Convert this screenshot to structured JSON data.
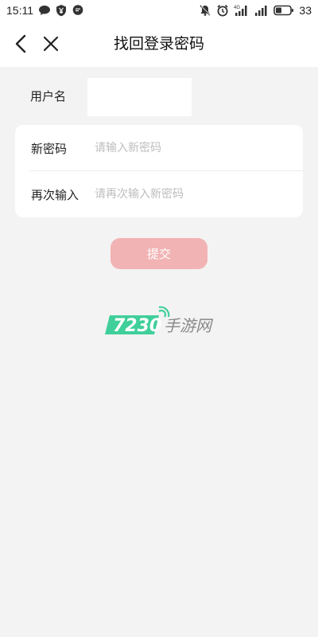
{
  "status_bar": {
    "time": "15:11",
    "battery_level": "33",
    "left_icons": [
      "chat-bubble-icon",
      "shield-yen-icon",
      "message-icon"
    ],
    "right_icons": [
      "mute-bell-icon",
      "alarm-icon",
      "4g-signal-icon",
      "signal-icon",
      "battery-icon"
    ],
    "network_label": "4G"
  },
  "nav": {
    "title": "找回登录密码",
    "back_icon": "chevron-left-icon",
    "close_icon": "close-icon"
  },
  "form": {
    "username_label": "用户名",
    "username_value": "",
    "new_password_label": "新密码",
    "new_password_placeholder": "请输入新密码",
    "confirm_password_label": "再次输入",
    "confirm_password_placeholder": "请再次输入新密码",
    "submit_label": "提交"
  },
  "watermark": {
    "number": "7230",
    "brand_text": "手游网"
  },
  "colors": {
    "background": "#f3f3f3",
    "submit_button": "#f2b3b4",
    "watermark_green": "#3fcf9a",
    "watermark_gray": "#888888"
  }
}
